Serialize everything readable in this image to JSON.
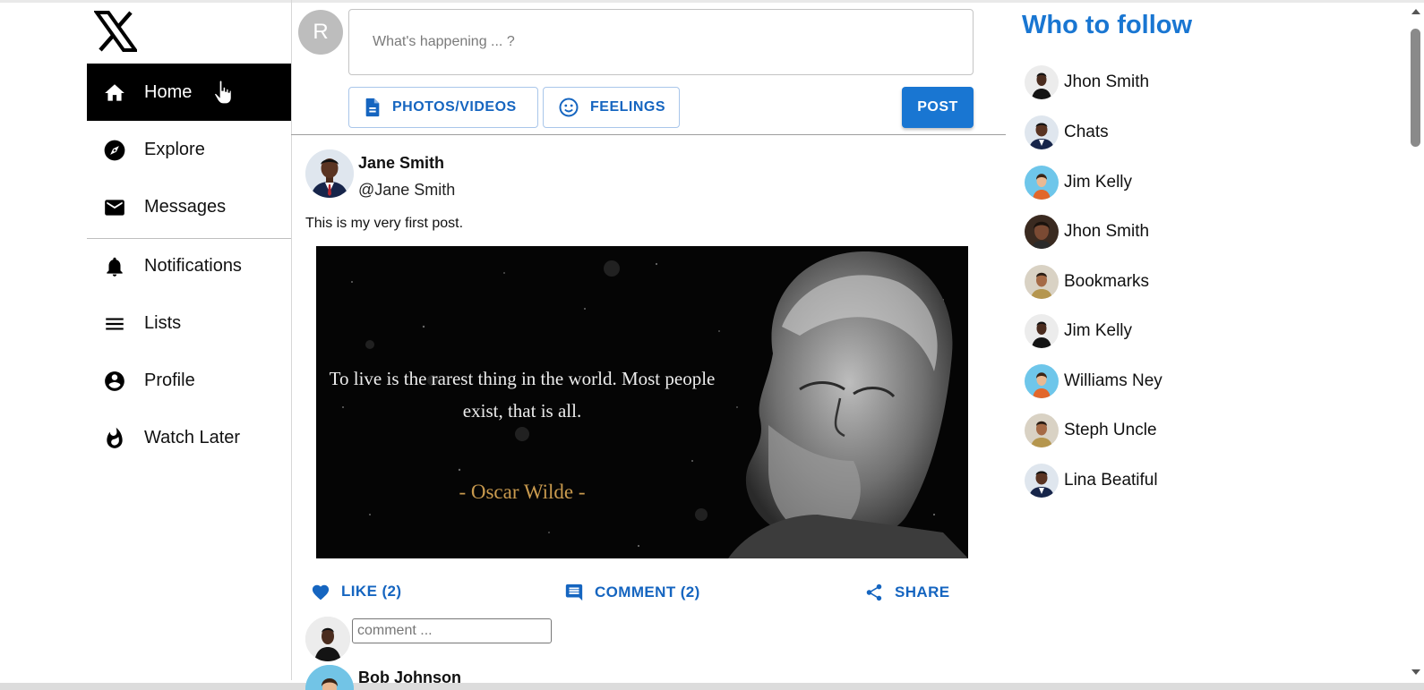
{
  "app": {
    "logo": "x-logo-icon"
  },
  "sidebar": {
    "items": [
      {
        "label": "Home",
        "icon": "home-icon",
        "active": true
      },
      {
        "label": "Explore",
        "icon": "compass-icon"
      },
      {
        "label": "Messages",
        "icon": "mail-icon"
      },
      {
        "label": "Notifications",
        "icon": "bell-icon"
      },
      {
        "label": "Lists",
        "icon": "list-icon"
      },
      {
        "label": "Profile",
        "icon": "account-circle-icon"
      },
      {
        "label": "Watch Later",
        "icon": "flame-icon"
      }
    ]
  },
  "composer": {
    "avatar_letter": "R",
    "placeholder": "What's happening ... ?",
    "photos_label": "PHOTOS/VIDEOS",
    "feelings_label": "FEELINGS",
    "post_label": "POST"
  },
  "post": {
    "author": "Jane Smith",
    "handle": "@Jane Smith",
    "text": "This is my very first post.",
    "image_quote": "To live is the rarest thing in the world. Most people exist, that is all.",
    "image_quote_author": "- Oscar Wilde -",
    "like_label": "LIKE (2)",
    "comment_label": "COMMENT (2)",
    "share_label": "SHARE",
    "comment_placeholder": "comment ..."
  },
  "next_post": {
    "author": "Bob Johnson"
  },
  "who_to_follow": {
    "title": "Who to follow",
    "people": [
      {
        "name": "Jhon Smith"
      },
      {
        "name": "Chats"
      },
      {
        "name": "Jim Kelly"
      },
      {
        "name": "Jhon Smith"
      },
      {
        "name": "Bookmarks"
      },
      {
        "name": "Jim Kelly"
      },
      {
        "name": "Williams Ney"
      },
      {
        "name": "Steph Uncle"
      },
      {
        "name": "Lina Beatiful"
      }
    ]
  },
  "colors": {
    "accent": "#1976d2",
    "accent_text": "#1565c0",
    "active_nav_bg": "#000000"
  }
}
